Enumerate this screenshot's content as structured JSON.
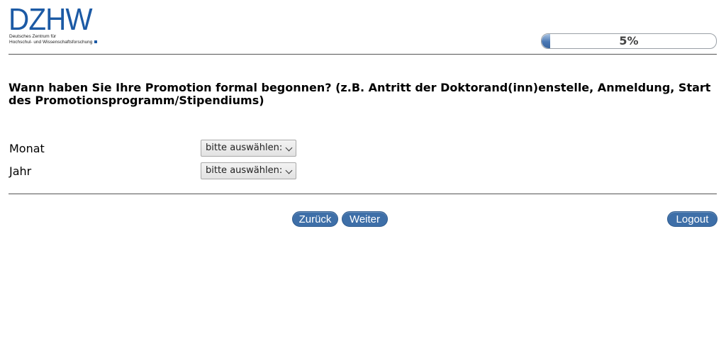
{
  "logo": {
    "word": "DZHW",
    "subtitle_line1": "Deutsches Zentrum für",
    "subtitle_line2": "Hochschul- und Wissenschaftsforschung"
  },
  "progress": {
    "label": "5%",
    "value": 0.05
  },
  "question": {
    "text": "Wann haben Sie Ihre Promotion formal begonnen? (z.B. Antritt der Doktorand(inn)enstelle, Anmeldung, Start des Promotionsprogramm/Stipendiums)"
  },
  "fields": [
    {
      "label": "Monat",
      "selected": "bitte auswählen:"
    },
    {
      "label": "Jahr",
      "selected": "bitte auswählen:"
    }
  ],
  "buttons": {
    "back": "Zurück",
    "next": "Weiter",
    "logout": "Logout"
  },
  "colors": {
    "brand": "#1c5aa5",
    "button": "#3e6fa8"
  }
}
